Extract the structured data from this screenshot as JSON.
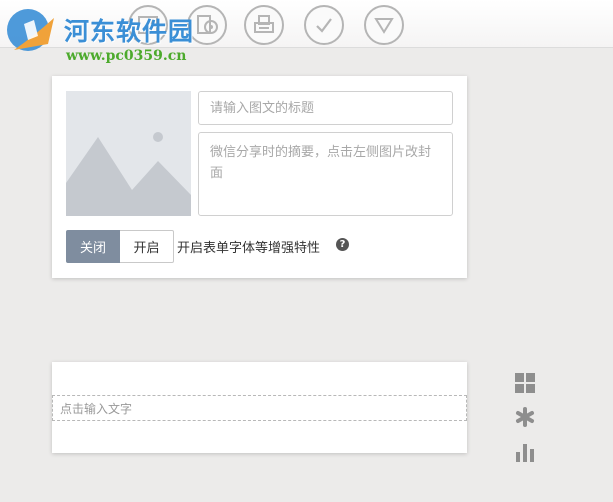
{
  "watermark": {
    "title": "河东软件园",
    "url": "www.pc0359.cn"
  },
  "toolbar": {
    "tools": [
      "image-icon",
      "audio-icon",
      "print-icon",
      "check-icon",
      "triangle-down-icon"
    ]
  },
  "article": {
    "title_placeholder": "请输入图文的标题",
    "summary_placeholder": "微信分享时的摘要，点击左侧图片改封面",
    "toggle_off_label": "关闭",
    "toggle_on_label": "开启",
    "enhance_label": "开启表单字体等增强特性",
    "help_glyph": "?"
  },
  "text_block": {
    "placeholder": "点击输入文字"
  },
  "side_tools": [
    "grid-icon",
    "asterisk-icon",
    "bar-chart-icon"
  ],
  "colors": {
    "toggle_active": "#7f8d9f",
    "background": "#ecebea",
    "logo_blue": "#3b8fd6",
    "logo_green": "#4caa2c"
  }
}
